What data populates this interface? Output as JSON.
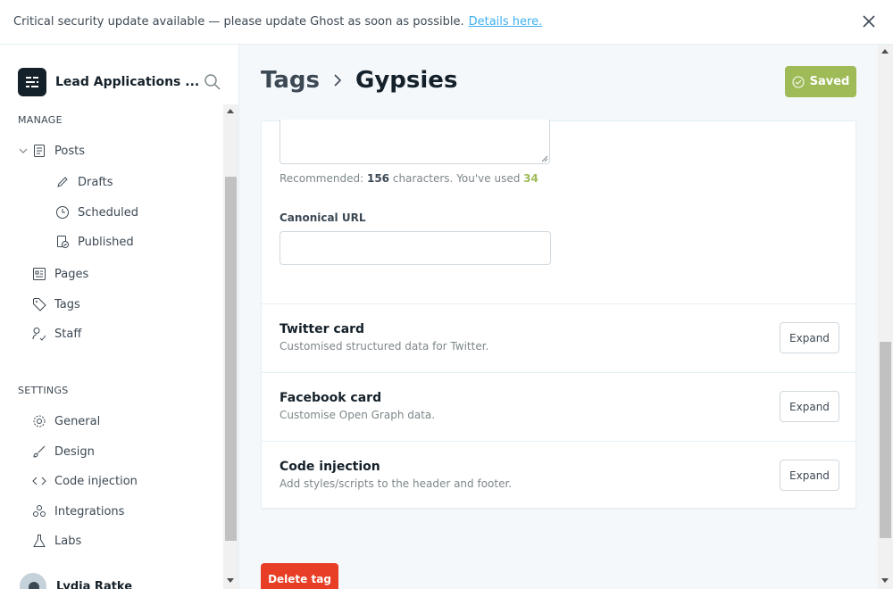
{
  "banner": {
    "message": "Critical security update available — please update Ghost as soon as possible.",
    "link": "Details here."
  },
  "sidebar": {
    "brand": "Lead Applications ...",
    "manage_heading": "MANAGE",
    "settings_heading": "SETTINGS",
    "manage_items": {
      "posts": "Posts",
      "drafts": "Drafts",
      "scheduled": "Scheduled",
      "published": "Published",
      "pages": "Pages",
      "tags": "Tags",
      "staff": "Staff"
    },
    "settings_items": {
      "general": "General",
      "design": "Design",
      "code_injection": "Code injection",
      "integrations": "Integrations",
      "labs": "Labs"
    },
    "user_name": "Lydia Ratke"
  },
  "header": {
    "crumb": "Tags",
    "title": "Gypsies",
    "saved_label": "Saved"
  },
  "meta": {
    "hint_prefix": "Recommended: ",
    "hint_recommended": "156",
    "hint_middle": " characters. You've used ",
    "hint_used": "34",
    "canonical_label": "Canonical URL",
    "canonical_value": ""
  },
  "sections": [
    {
      "title": "Twitter card",
      "desc": "Customised structured data for Twitter.",
      "button": "Expand"
    },
    {
      "title": "Facebook card",
      "desc": "Customise Open Graph data.",
      "button": "Expand"
    },
    {
      "title": "Code injection",
      "desc": "Add styles/scripts to the header and footer.",
      "button": "Expand"
    }
  ],
  "delete_label": "Delete tag",
  "colors": {
    "saved_green": "#9fbb58",
    "delete_red": "#e73e25",
    "link_blue": "#3eb0ef"
  }
}
